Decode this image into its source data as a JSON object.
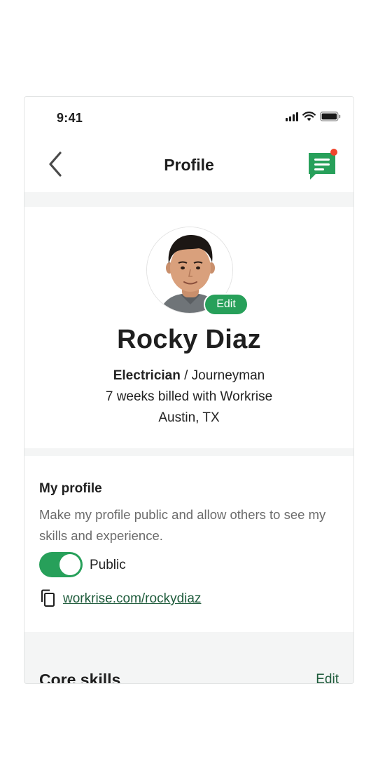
{
  "status_bar": {
    "time": "9:41",
    "icons": [
      "signal-icon",
      "wifi-icon",
      "battery-icon"
    ]
  },
  "nav": {
    "back_icon": "chevron-left-icon",
    "title": "Profile",
    "chat_icon": "chat-bubble-icon",
    "has_notification": true
  },
  "profile": {
    "edit_label": "Edit",
    "name": "Rocky Diaz",
    "trade": "Electrician",
    "level": " / Journeyman",
    "billed": "7 weeks billed with Workrise",
    "location": "Austin, TX"
  },
  "my_profile": {
    "title": "My profile",
    "description": "Make my profile public and allow others to see my skills and experience.",
    "toggle_on": true,
    "toggle_label": "Public",
    "link": "workrise.com/rockydiaz",
    "copy_icon": "copy-icon"
  },
  "core_skills": {
    "title": "Core skills",
    "edit_label": "Edit"
  },
  "colors": {
    "brand_green": "#27a05a",
    "link_green": "#1e5b3b",
    "notification_red": "#f0452c",
    "page_gray": "#f4f5f5"
  }
}
